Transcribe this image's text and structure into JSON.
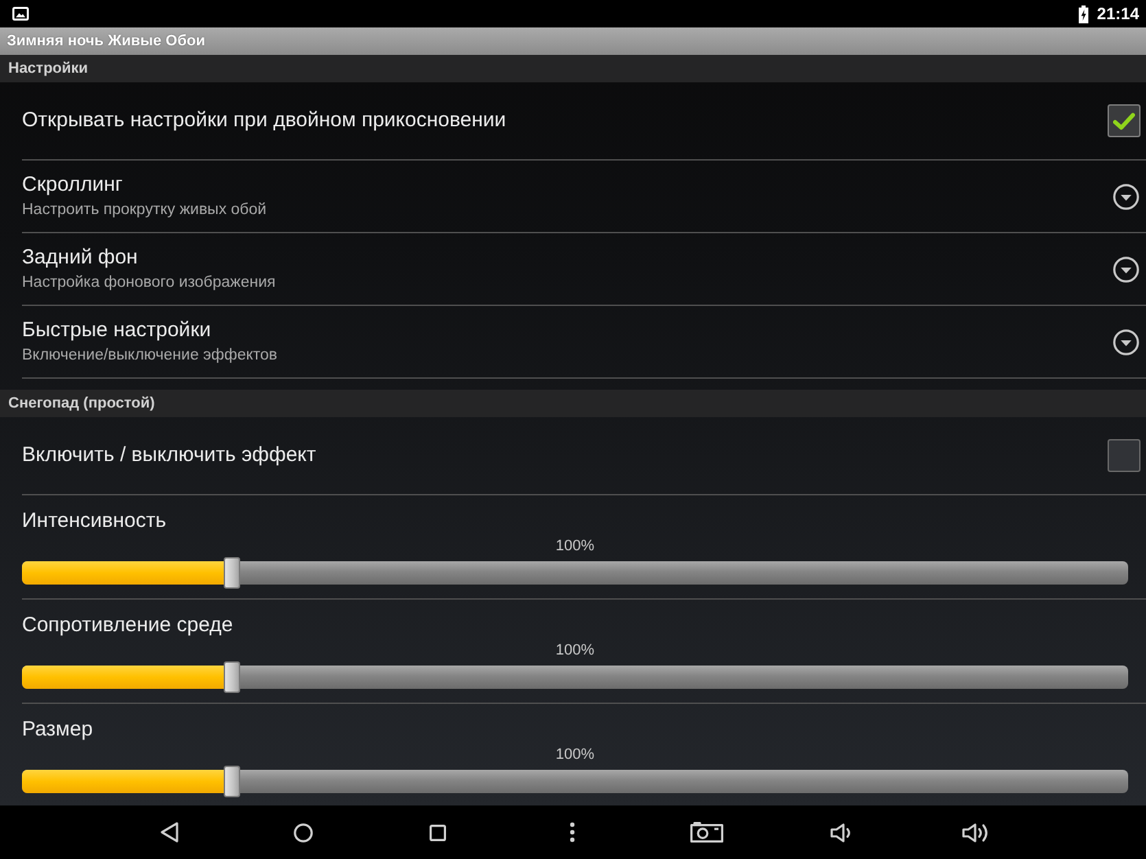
{
  "status_bar": {
    "time": "21:14"
  },
  "title_bar": {
    "title": "Зимняя ночь Живые Обои"
  },
  "sections": [
    {
      "title": "Настройки",
      "items": [
        {
          "kind": "checkbox",
          "title": "Открывать настройки при двойном прикосновении",
          "checked": true
        },
        {
          "kind": "submenu",
          "title": "Скроллинг",
          "summary": "Настроить прокрутку живых обой"
        },
        {
          "kind": "submenu",
          "title": "Задний фон",
          "summary": "Настройка фонового изображения"
        },
        {
          "kind": "submenu",
          "title": "Быстрые настройки",
          "summary": "Включение/выключение эффектов"
        }
      ]
    },
    {
      "title": "Снегопад (простой)",
      "items": [
        {
          "kind": "checkbox",
          "title": "Включить / выключить эффект",
          "checked": false
        },
        {
          "kind": "slider",
          "title": "Интенсивность",
          "reading": "100%",
          "level": 0.19
        },
        {
          "kind": "slider",
          "title": "Сопротивление среде",
          "reading": "100%",
          "level": 0.19
        },
        {
          "kind": "slider",
          "title": "Размер",
          "reading": "100%",
          "level": 0.19
        }
      ]
    }
  ]
}
